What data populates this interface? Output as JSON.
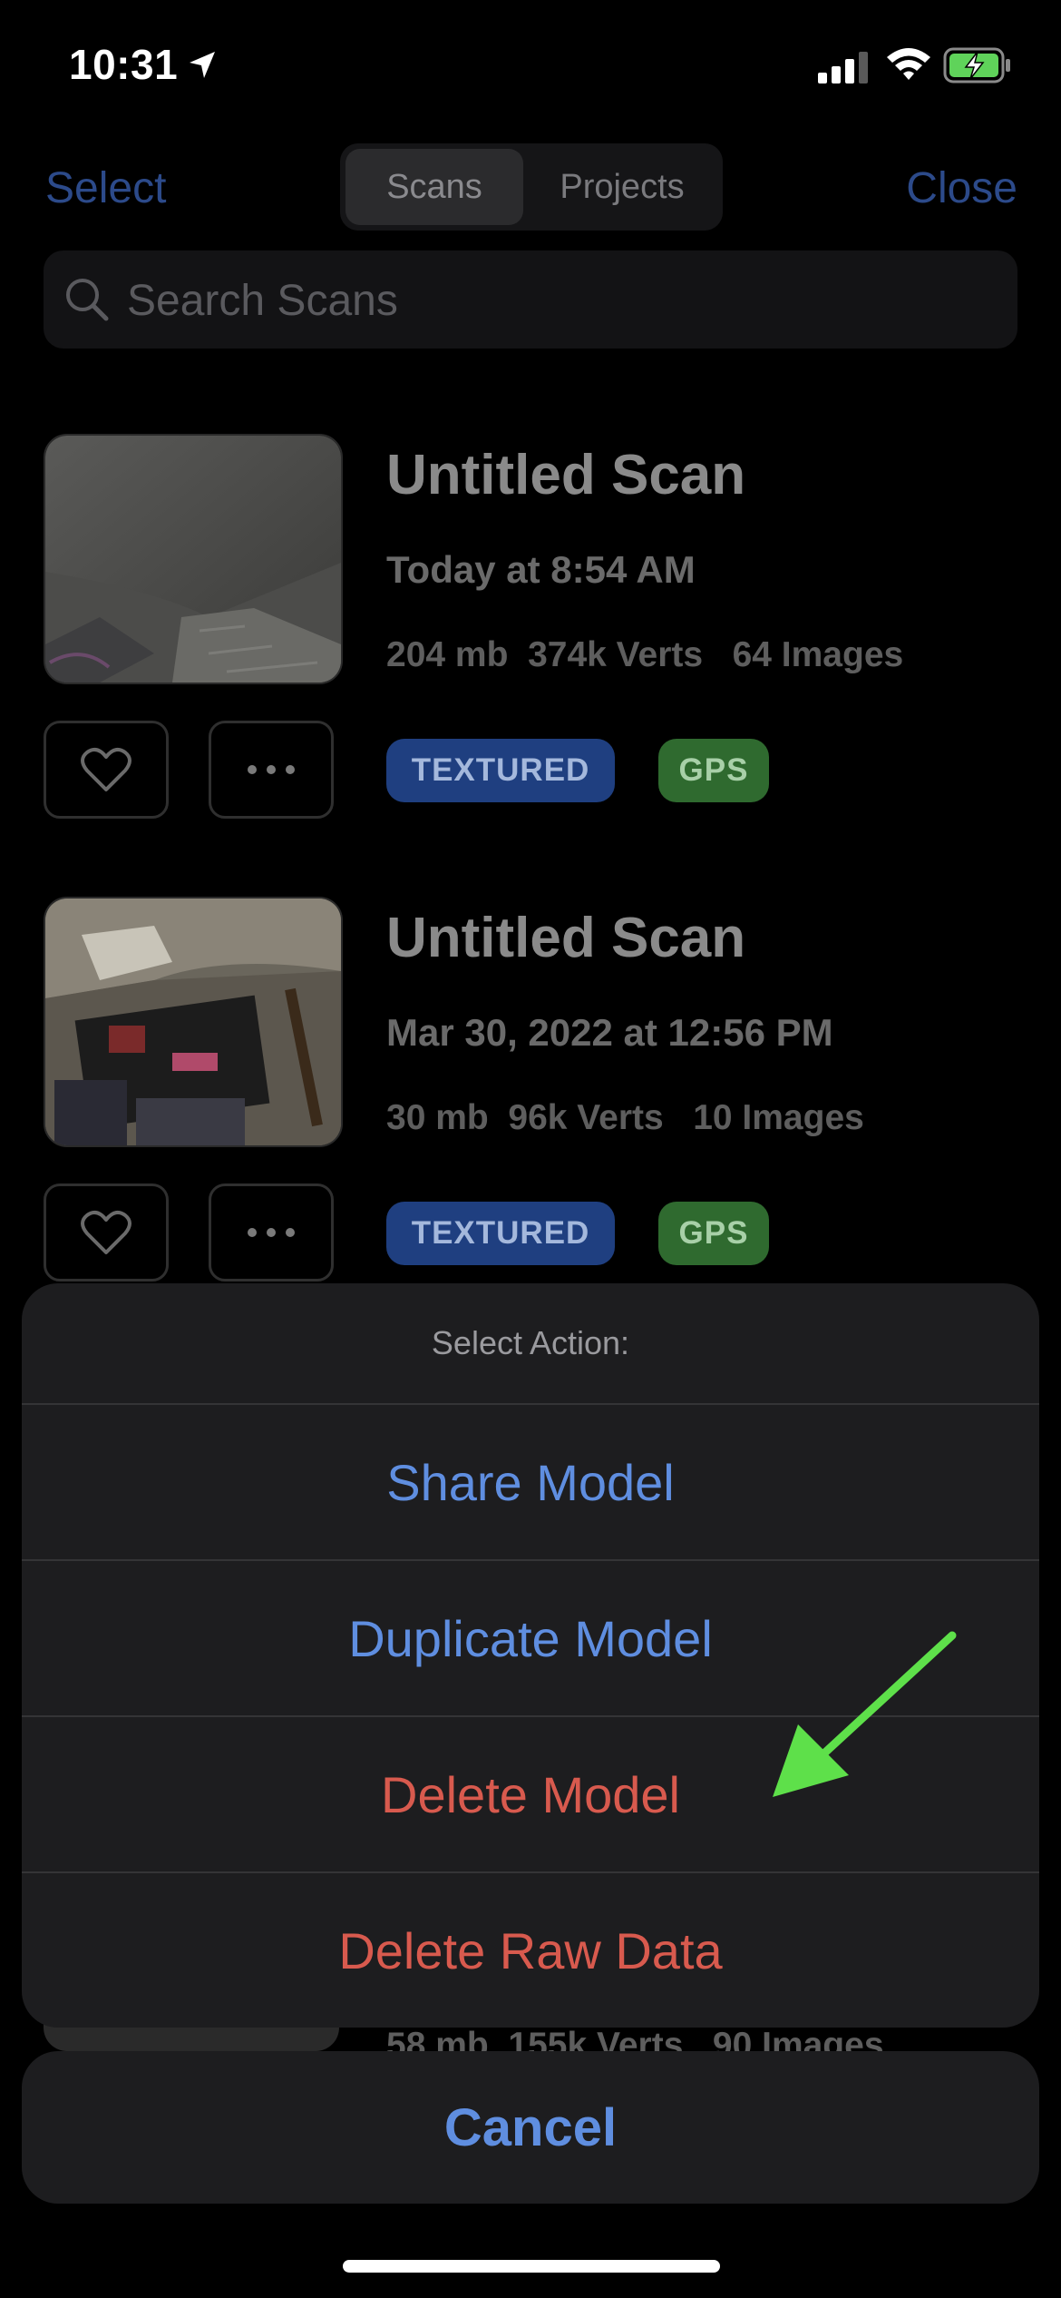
{
  "status_bar": {
    "time": "10:31"
  },
  "nav": {
    "select_label": "Select",
    "close_label": "Close",
    "tabs": [
      "Scans",
      "Projects"
    ],
    "selected_tab": "Scans"
  },
  "search": {
    "placeholder": "Search Scans"
  },
  "scans": [
    {
      "title": "Untitled Scan",
      "date": "Today at 8:54 AM",
      "stats": "204 mb  374k Verts   64 Images",
      "badges": [
        "TEXTURED",
        "GPS"
      ]
    },
    {
      "title": "Untitled Scan",
      "date": "Mar 30, 2022 at 12:56 PM",
      "stats": "30 mb  96k Verts   10 Images",
      "badges": [
        "TEXTURED",
        "GPS"
      ]
    }
  ],
  "partial_scan_stats": "58 mb  155k Verts   90 Images",
  "action_sheet": {
    "title": "Select Action:",
    "actions": [
      {
        "label": "Share Model",
        "style": "default"
      },
      {
        "label": "Duplicate Model",
        "style": "default"
      },
      {
        "label": "Delete Model",
        "style": "destructive"
      },
      {
        "label": "Delete Raw Data",
        "style": "destructive"
      }
    ],
    "cancel_label": "Cancel"
  },
  "colors": {
    "accent_blue": "#5f8ee0",
    "destructive_red": "#d85a4e",
    "annotation_arrow": "#5ee04a"
  },
  "icons": [
    "location-arrow-icon",
    "cellular-signal-icon",
    "wifi-icon",
    "battery-charging-icon",
    "search-icon",
    "heart-icon",
    "ellipsis-icon"
  ]
}
